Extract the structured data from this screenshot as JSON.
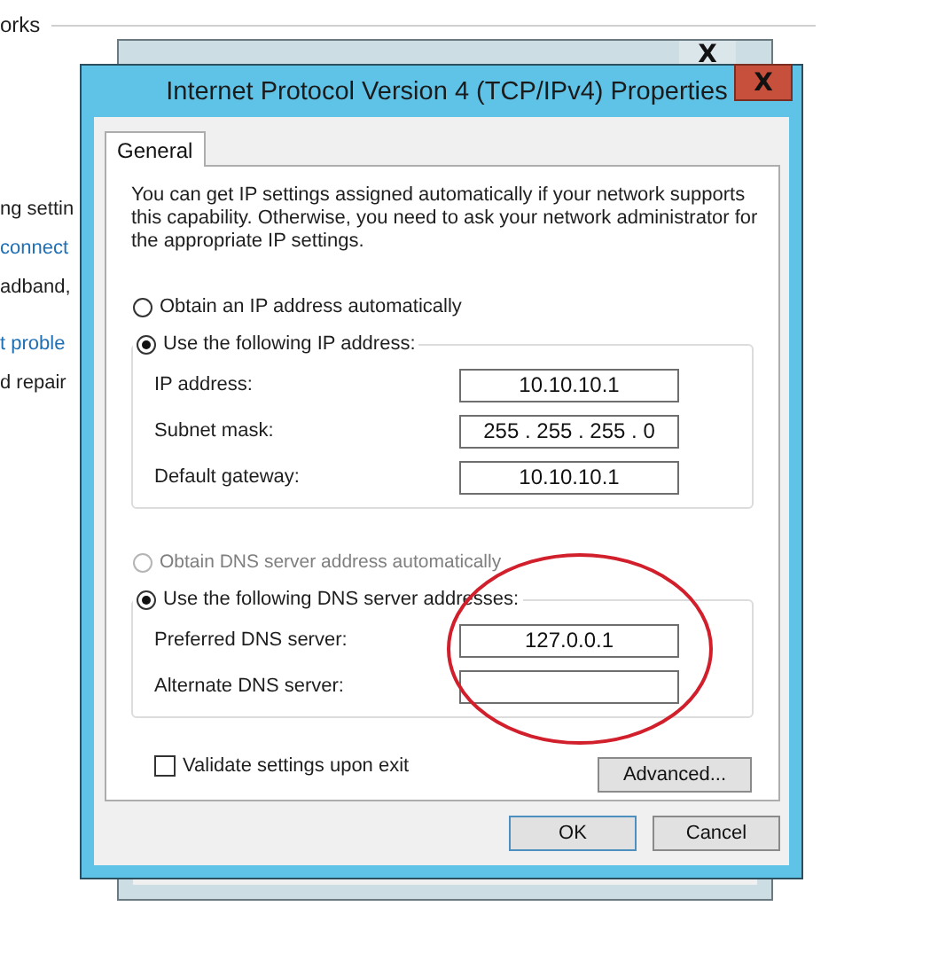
{
  "background_page": {
    "heading": "orks",
    "sections": [
      {
        "lines": [
          {
            "text": "ng settin",
            "kind": "text"
          },
          {
            "text": "connect",
            "kind": "link"
          },
          {
            "text": "adband,",
            "kind": "text"
          }
        ]
      },
      {
        "lines": [
          {
            "text": "t proble",
            "kind": "link"
          },
          {
            "text": "d repair",
            "kind": "text"
          }
        ]
      }
    ]
  },
  "ethernet_status": {
    "close": "X"
  },
  "dialog": {
    "title": "Internet Protocol Version 4 (TCP/IPv4) Properties",
    "close": "X",
    "tabs": [
      {
        "label": "General",
        "selected": true
      }
    ],
    "description": "You can get IP settings assigned automatically if your network supports this capability. Otherwise, you need to ask your network administrator for the appropriate IP settings.",
    "ip_mode": [
      {
        "label": "Obtain an IP address automatically",
        "selected": false,
        "disabled": false
      },
      {
        "label": "Use the following IP address:",
        "selected": true,
        "disabled": false
      }
    ],
    "ip_fields": [
      {
        "label": "IP address:",
        "value": "10.10.10.1"
      },
      {
        "label": "Subnet mask:",
        "value": "255 . 255 . 255 . 0"
      },
      {
        "label": "Default gateway:",
        "value": "10.10.10.1"
      }
    ],
    "dns_mode": [
      {
        "label": "Obtain DNS server address automatically",
        "selected": false,
        "disabled": true
      },
      {
        "label": "Use the following DNS server addresses:",
        "selected": true,
        "disabled": false
      }
    ],
    "dns_fields": [
      {
        "label": "Preferred DNS server:",
        "value": "127.0.0.1"
      },
      {
        "label": "Alternate DNS server:"
      }
    ],
    "validate": {
      "label": "Validate settings upon exit",
      "checked": false
    },
    "advanced_button": "Advanced...",
    "buttons": [
      {
        "label": "OK",
        "default": true
      },
      {
        "label": "Cancel",
        "default": false
      }
    ]
  },
  "annotations": [
    {
      "kind": "ellipse"
    }
  ]
}
